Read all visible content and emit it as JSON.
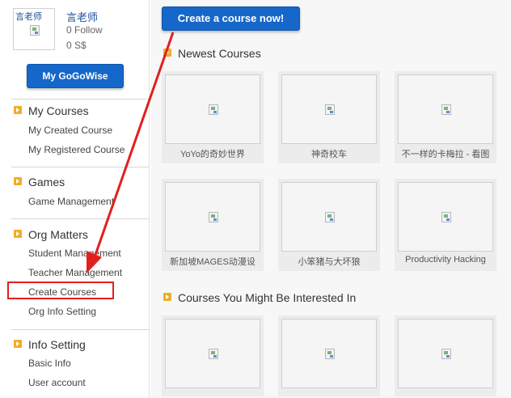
{
  "profile": {
    "avatar_label": "言老师",
    "name": "言老师",
    "follow": "0 Follow",
    "balance": "0 S$"
  },
  "buttons": {
    "my_gogowise": "My GoGoWise",
    "create_course": "Create a course now!"
  },
  "sidebar": {
    "sections": [
      {
        "title": "My Courses",
        "items": [
          "My Created Course",
          "My Registered Course"
        ]
      },
      {
        "title": "Games",
        "items": [
          "Game Management"
        ]
      },
      {
        "title": "Org Matters",
        "items": [
          "Student Management",
          "Teacher Management",
          "Create Courses",
          "Org Info Setting"
        ]
      },
      {
        "title": "Info Setting",
        "items": [
          "Basic Info",
          "User account"
        ]
      }
    ]
  },
  "main": {
    "newest_heading": "Newest Courses",
    "newest_courses": [
      "YoYo的奇妙世界",
      "神奇校车",
      "不一样的卡梅拉 - 看图",
      "新加坡MAGES动漫设",
      "小笨猪与大坏狼",
      "Productivity Hacking"
    ],
    "interest_heading": "Courses You Might Be Interested In",
    "interest_courses": [
      "",
      "",
      ""
    ]
  },
  "colors": {
    "button_blue": "#1567c9",
    "section_icon": "#f0ad25",
    "annotation_red": "#e21f1f"
  }
}
